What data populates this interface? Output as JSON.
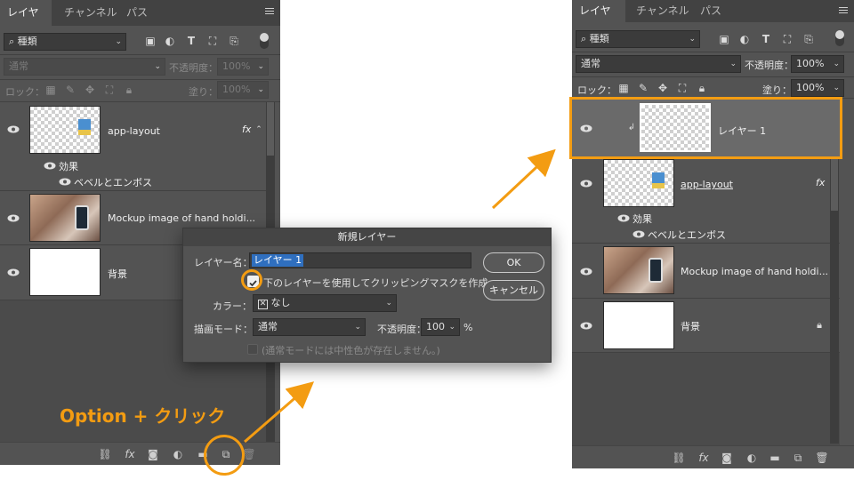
{
  "left_panel": {
    "tabs": [
      "レイヤー",
      "チャンネル",
      "パス"
    ],
    "filter_value": "種類",
    "blend_mode": "通常",
    "opacity_label": "不透明度：",
    "opacity_value": "100%",
    "lock_label": "ロック：",
    "fill_label": "塗り：",
    "fill_value": "100%",
    "layers": [
      {
        "name": "app-layout",
        "effects_label": "効果",
        "effect": "ベベルとエンボス",
        "fx": "fx"
      },
      {
        "name": "Mockup image of hand holdi..."
      },
      {
        "name": "背景"
      }
    ]
  },
  "dialog": {
    "title": "新規レイヤー",
    "name_label": "レイヤー名：",
    "name_value": "レイヤー 1",
    "clip_label": "下のレイヤーを使用してクリッピングマスクを作成",
    "color_label": "カラー：",
    "color_value": "なし",
    "mode_label": "描画モード：",
    "mode_value": "通常",
    "opacity_label": "不透明度：",
    "opacity_value": "100",
    "opacity_unit": "%",
    "neutral_label": "(通常モードには中性色が存在しません。)",
    "ok_label": "OK",
    "cancel_label": "キャンセル"
  },
  "annotation": {
    "text": "Option + クリック",
    "accent_color": "#f39c12"
  },
  "right_panel": {
    "tabs": [
      "レイヤー",
      "チャンネル",
      "パス"
    ],
    "filter_value": "種類",
    "blend_mode": "通常",
    "opacity_label": "不透明度：",
    "opacity_value": "100%",
    "lock_label": "ロック：",
    "fill_label": "塗り：",
    "fill_value": "100%",
    "layers": [
      {
        "name": "レイヤー 1"
      },
      {
        "name": "app-layout",
        "effects_label": "効果",
        "effect": "ベベルとエンボス",
        "fx": "fx"
      },
      {
        "name": "Mockup image of hand holdi..."
      },
      {
        "name": "背景"
      }
    ]
  }
}
